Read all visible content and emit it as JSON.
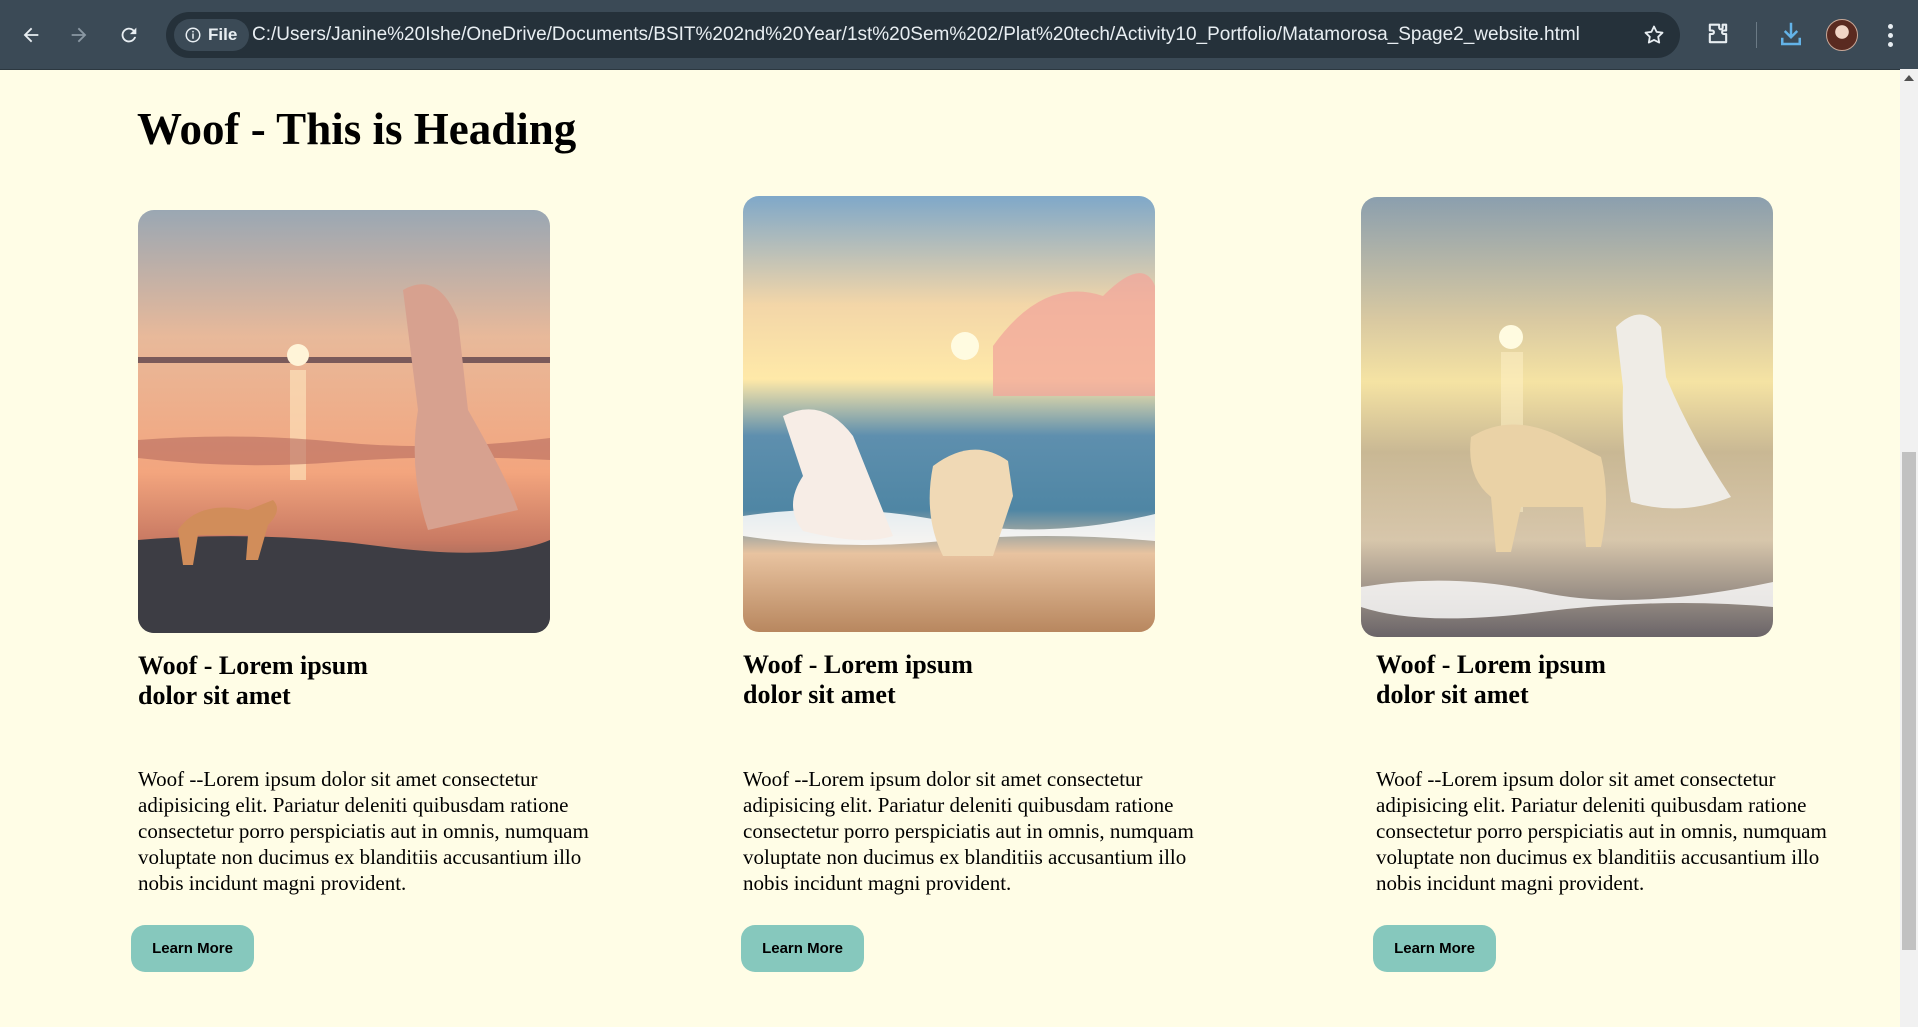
{
  "browser": {
    "file_label": "File",
    "url": "C:/Users/Janine%20Ishe/OneDrive/Documents/BSIT%202nd%20Year/1st%20Sem%202/Plat%20tech/Activity10_Portfolio/Matamorosa_Spage2_website.html"
  },
  "page": {
    "heading": "Woof - This is Heading",
    "cards": [
      {
        "title": "Woof - Lorem ipsum dolor sit amet",
        "text": "Woof --Lorem ipsum dolor sit amet consectetur adipisicing elit. Pariatur deleniti quibusdam ratione consectetur porro perspiciatis aut in omnis, numquam voluptate non ducimus ex blanditiis accusantium illo nobis incidunt magni provident.",
        "button": "Learn More",
        "image": "sunset-beach-girl-dog"
      },
      {
        "title": "Woof - Lorem ipsum dolor sit amet",
        "text": "Woof --Lorem ipsum dolor sit amet consectetur adipisicing elit. Pariatur deleniti quibusdam ratione consectetur porro perspiciatis aut in omnis, numquam voluptate non ducimus ex blanditiis accusantium illo nobis incidunt magni provident.",
        "button": "Learn More",
        "image": "golden-hour-beach-girl-dog"
      },
      {
        "title": "Woof - Lorem ipsum dolor sit amet",
        "text": "Woof --Lorem ipsum dolor sit amet consectetur adipisicing elit. Pariatur deleniti quibusdam ratione consectetur porro perspiciatis aut in omnis, numquam voluptate non ducimus ex blanditiis accusantium illo nobis incidunt magni provident.",
        "button": "Learn More",
        "image": "bright-shore-girl-dog"
      }
    ]
  },
  "colors": {
    "page_bg": "#fffde6",
    "button_bg": "#86c8bd",
    "chrome_bg": "#3b4a56"
  }
}
